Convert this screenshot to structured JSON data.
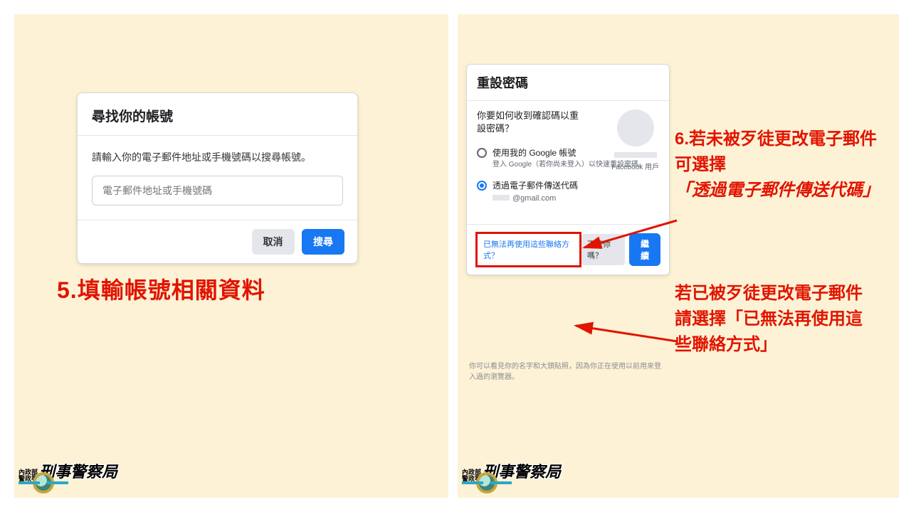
{
  "left": {
    "anno5": "5.填輸帳號相關資料",
    "card": {
      "title": "尋找你的帳號",
      "desc": "請輸入你的電子郵件地址或手機號碼以搜尋帳號。",
      "placeholder": "電子郵件地址或手機號碼",
      "cancel": "取消",
      "search": "搜尋"
    }
  },
  "right": {
    "card": {
      "title": "重設密碼",
      "question": "你要如何收到確認碼以重設密碼？",
      "opt1": {
        "label": "使用我的 Google 帳號",
        "sub": "登入 Google（若你尚未登入）以快速重設密碼。"
      },
      "opt2": {
        "label": "透過電子郵件傳送代碼",
        "email": "@gmail.com"
      },
      "avatarName": "Facebook 用戶",
      "noAccess": "已無法再使用這些聯絡方式？",
      "notYou": "不是你嗎？",
      "cont": "繼續",
      "hint": "你可以看見你的名字和大頭貼照，因為你正在使用以前用來登入過的瀏覽器。"
    },
    "anno6a_l1": "6.若未被歹徒更改電子郵件",
    "anno6a_l2": "可選擇",
    "anno6a_l3": "「透過電子郵件傳送代碼」",
    "anno6b_l1": "若已被歹徒更改電子郵件",
    "anno6b_l2": "請選擇「已無法再使用這",
    "anno6b_l3": "些聯絡方式」"
  },
  "badge": {
    "line1": "內政部",
    "line2": "警政署",
    "big": "刑事警察局"
  }
}
